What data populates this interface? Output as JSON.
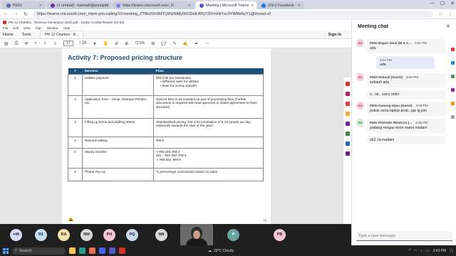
{
  "browser": {
    "tabs": [
      {
        "label": "PEDI",
        "color": "#5b6abf",
        "active": false
      },
      {
        "label": "(1 unread) - hasmah@pnmtpdp",
        "color": "#6a33a3",
        "active": false
      },
      {
        "label": "https://teams.microsoft.com/_#/",
        "color": "#7b83eb",
        "active": false
      },
      {
        "label": "Meeting | Microsoft Teams",
        "color": "#5059c9",
        "active": true
      },
      {
        "label": "(20+) Facebook",
        "color": "#1877f2",
        "active": false
      }
    ],
    "url": "https://teams.microsoft.com/_#/pre-join-calling/19:meeting_ZTMzZDc5MTQtNzNiMy00ODdiLWFjY2ItYmNiYzc0YWRkNzY1@thread.v2",
    "win_min": "—",
    "win_max": "☐",
    "win_close": "✕"
  },
  "acrobat": {
    "title": "PIK 12 Charters - Revenue Generation (S02).pdf - Adobe Acrobat Reader (64-bit)",
    "menu": [
      "File",
      "Edit",
      "View",
      "Sign",
      "Window",
      "Help"
    ],
    "tabs": {
      "home": "Home",
      "tools": "Tools",
      "doc": "PIK 12 Charters - R...",
      "signin": "Sign In"
    },
    "page_current": "17",
    "page_total": "/ 28",
    "zoom": "72.8%"
  },
  "pdf": {
    "heading": "Activity 7: Proposed pricing structure",
    "columns": [
      "#",
      "Services",
      "Price"
    ],
    "rows": [
      {
        "no": "1",
        "service": "Utilities payment",
        "price": "RM 0.50 per transaction",
        "bullets": [
          "Different rates for utilities",
          "Rate for money transfer"
        ]
      },
      {
        "no": "2",
        "service": "Application form – iSinar, Bantuan Prihatin, etc.",
        "price": "Service fees to be included as part of processing fees (Further discussion is required with lead agencies to obtain agreement on fees structure)",
        "bullets": []
      },
      {
        "no": "3",
        "service": "Filling up forms and drafting letters",
        "price": "Standardised pricing: RM 3.50 (estimation of 5-10 people per day especially towards the start of the year)",
        "bullets": []
      },
      {
        "no": "4",
        "service": "Resume writing",
        "price": "RM 8",
        "bullets": []
      },
      {
        "no": "5",
        "service": "Money transfer",
        "price": "< RM 200: RM 2\n201 – RM 300: RM 3\n➢  RM 501: RM 5",
        "bullets": []
      },
      {
        "no": "6",
        "service": "Phone Top Up",
        "price": "% percentage commission based on sales",
        "bullets": []
      }
    ],
    "page_number": "16"
  },
  "participants": [
    {
      "initials": "+46",
      "color": "#d6dcf5"
    },
    {
      "initials": "R1",
      "color": "#c5e0f5"
    },
    {
      "initials": "RA",
      "color": "#f3e2a9"
    },
    {
      "initials": "RM",
      "color": "#d9d9d9"
    },
    {
      "initials": "PH",
      "color": "#f5c6d3"
    },
    {
      "initials": "PQ",
      "color": "#c9d8f2"
    },
    {
      "initials": "NN",
      "color": "#d9d9d9"
    },
    {
      "initials": "P",
      "color": "#6aa3a0"
    },
    {
      "initials": "PB",
      "color": "#f5c6d3"
    }
  ],
  "chat": {
    "title": "Meeting chat",
    "close_icon": "✕",
    "messages": [
      {
        "initials": "PS",
        "avatar_color": "#f5d0dc",
        "name": "PEDI Bagan Serai (M & A...",
        "time": "3:01 PM",
        "text": "ada"
      },
      {
        "mine": true,
        "time": "3:02 PM",
        "text": "ada"
      },
      {
        "initials": "PS",
        "avatar_color": "#f5d0dc",
        "name": "PEDI Sebauh (Guest)",
        "time": "3:04 PM",
        "text": "sebauh ada",
        "extra": [
          "o.. ok.. sorry mdm"
        ]
      },
      {
        "initials": "PH",
        "avatar_color": "#f5d0dc",
        "name": "PEDI Gunung Hijau (Guest)",
        "time": "3:06 PM",
        "text": "pokok sena laptop prob...jap lg join"
      },
      {
        "initials": "PR",
        "avatar_color": "#d4ebd8",
        "name": "PEDI PADANG RENGAS (...",
        "time": "3:35 PM",
        "text": "padang rengas mom mana madam",
        "extra": [
          "ok2..tq madam"
        ]
      }
    ],
    "compose_placeholder": "Type a new message"
  },
  "taskbar": {
    "search": "Search",
    "weather": "29°C  Cloudy",
    "time": "3:43 PM"
  }
}
